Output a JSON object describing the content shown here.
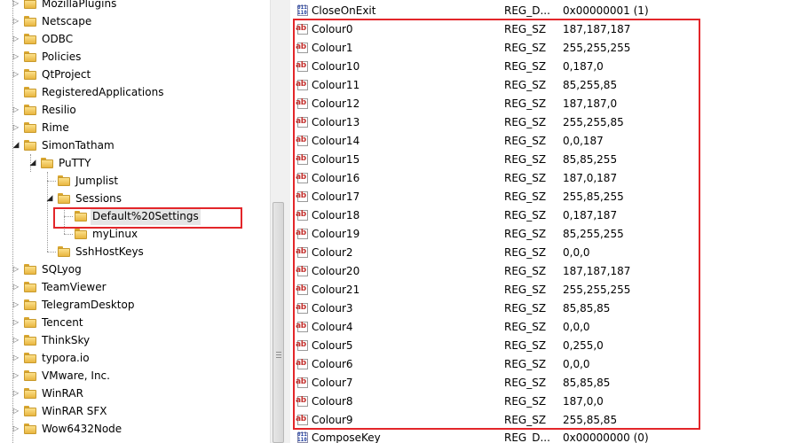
{
  "tree": {
    "items": [
      {
        "label": "MozillaPlugins",
        "expand": "collapsed"
      },
      {
        "label": "Netscape",
        "expand": "collapsed"
      },
      {
        "label": "ODBC",
        "expand": "collapsed"
      },
      {
        "label": "Policies",
        "expand": "collapsed"
      },
      {
        "label": "QtProject",
        "expand": "collapsed"
      },
      {
        "label": "RegisteredApplications",
        "expand": "none"
      },
      {
        "label": "Resilio",
        "expand": "collapsed"
      },
      {
        "label": "Rime",
        "expand": "collapsed"
      },
      {
        "label": "SimonTatham",
        "expand": "expanded"
      },
      {
        "label": "PuTTY",
        "expand": "expanded"
      },
      {
        "label": "Jumplist",
        "expand": "none"
      },
      {
        "label": "Sessions",
        "expand": "expanded"
      },
      {
        "label": "Default%20Settings",
        "expand": "none",
        "selected": true
      },
      {
        "label": "myLinux",
        "expand": "none"
      },
      {
        "label": "SshHostKeys",
        "expand": "none"
      },
      {
        "label": "SQLyog",
        "expand": "collapsed"
      },
      {
        "label": "TeamViewer",
        "expand": "collapsed"
      },
      {
        "label": "TelegramDesktop",
        "expand": "collapsed"
      },
      {
        "label": "Tencent",
        "expand": "collapsed"
      },
      {
        "label": "ThinkSky",
        "expand": "collapsed"
      },
      {
        "label": "typora.io",
        "expand": "collapsed"
      },
      {
        "label": "VMware, Inc.",
        "expand": "collapsed"
      },
      {
        "label": "WinRAR",
        "expand": "collapsed"
      },
      {
        "label": "WinRAR SFX",
        "expand": "collapsed"
      },
      {
        "label": "Wow6432Node",
        "expand": "collapsed"
      }
    ]
  },
  "values": [
    {
      "name": "CloseOnExit",
      "type": "REG_D...",
      "data": "0x00000001 (1)",
      "icon": "binary-value-icon"
    },
    {
      "name": "Colour0",
      "type": "REG_SZ",
      "data": "187,187,187",
      "icon": "string-value-icon"
    },
    {
      "name": "Colour1",
      "type": "REG_SZ",
      "data": "255,255,255",
      "icon": "string-value-icon"
    },
    {
      "name": "Colour10",
      "type": "REG_SZ",
      "data": "0,187,0",
      "icon": "string-value-icon"
    },
    {
      "name": "Colour11",
      "type": "REG_SZ",
      "data": "85,255,85",
      "icon": "string-value-icon"
    },
    {
      "name": "Colour12",
      "type": "REG_SZ",
      "data": "187,187,0",
      "icon": "string-value-icon"
    },
    {
      "name": "Colour13",
      "type": "REG_SZ",
      "data": "255,255,85",
      "icon": "string-value-icon"
    },
    {
      "name": "Colour14",
      "type": "REG_SZ",
      "data": "0,0,187",
      "icon": "string-value-icon"
    },
    {
      "name": "Colour15",
      "type": "REG_SZ",
      "data": "85,85,255",
      "icon": "string-value-icon"
    },
    {
      "name": "Colour16",
      "type": "REG_SZ",
      "data": "187,0,187",
      "icon": "string-value-icon"
    },
    {
      "name": "Colour17",
      "type": "REG_SZ",
      "data": "255,85,255",
      "icon": "string-value-icon"
    },
    {
      "name": "Colour18",
      "type": "REG_SZ",
      "data": "0,187,187",
      "icon": "string-value-icon"
    },
    {
      "name": "Colour19",
      "type": "REG_SZ",
      "data": "85,255,255",
      "icon": "string-value-icon"
    },
    {
      "name": "Colour2",
      "type": "REG_SZ",
      "data": "0,0,0",
      "icon": "string-value-icon"
    },
    {
      "name": "Colour20",
      "type": "REG_SZ",
      "data": "187,187,187",
      "icon": "string-value-icon"
    },
    {
      "name": "Colour21",
      "type": "REG_SZ",
      "data": "255,255,255",
      "icon": "string-value-icon"
    },
    {
      "name": "Colour3",
      "type": "REG_SZ",
      "data": "85,85,85",
      "icon": "string-value-icon"
    },
    {
      "name": "Colour4",
      "type": "REG_SZ",
      "data": "0,0,0",
      "icon": "string-value-icon"
    },
    {
      "name": "Colour5",
      "type": "REG_SZ",
      "data": "0,255,0",
      "icon": "string-value-icon"
    },
    {
      "name": "Colour6",
      "type": "REG_SZ",
      "data": "0,0,0",
      "icon": "string-value-icon"
    },
    {
      "name": "Colour7",
      "type": "REG_SZ",
      "data": "85,85,85",
      "icon": "string-value-icon"
    },
    {
      "name": "Colour8",
      "type": "REG_SZ",
      "data": "187,0,0",
      "icon": "string-value-icon"
    },
    {
      "name": "Colour9",
      "type": "REG_SZ",
      "data": "255,85,85",
      "icon": "string-value-icon"
    },
    {
      "name": "ComposeKey",
      "type": "REG_D...",
      "data": "0x00000000 (0)",
      "icon": "binary-value-icon"
    }
  ],
  "icons": {
    "string_glyph": "ab",
    "binary_glyph": "011\n110"
  },
  "colors": {
    "annotation_red": "#e3262a",
    "folder_yellow": "#f3c95a",
    "selection_gray": "#e5e5e5"
  }
}
